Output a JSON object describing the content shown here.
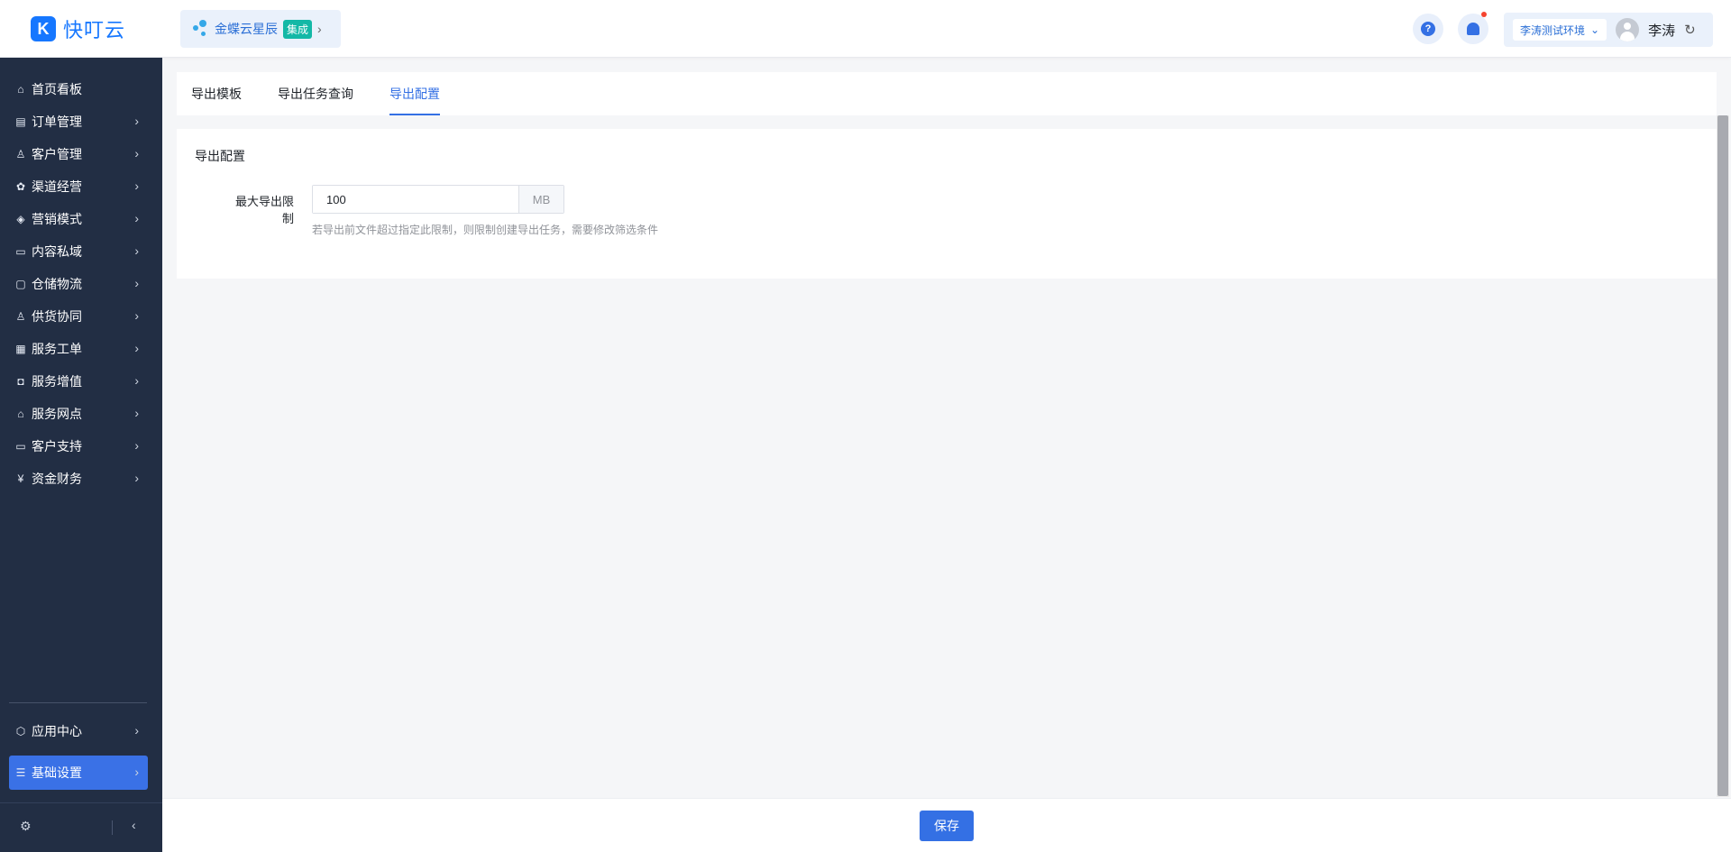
{
  "brand": {
    "name": "快叮云"
  },
  "integration": {
    "label": "金蝶云星辰",
    "badge": "集成"
  },
  "header": {
    "env_label": "李涛测试环境",
    "user_name": "李涛"
  },
  "sidebar": {
    "items": [
      {
        "label": "首页看板",
        "icon": "home-icon"
      },
      {
        "label": "订单管理",
        "icon": "clipboard-icon"
      },
      {
        "label": "客户管理",
        "icon": "user-icon"
      },
      {
        "label": "渠道经营",
        "icon": "channel-icon"
      },
      {
        "label": "营销模式",
        "icon": "tag-icon"
      },
      {
        "label": "内容私域",
        "icon": "image-icon"
      },
      {
        "label": "仓储物流",
        "icon": "warehouse-icon"
      },
      {
        "label": "供货协同",
        "icon": "supplier-icon"
      },
      {
        "label": "服务工单",
        "icon": "ticket-icon"
      },
      {
        "label": "服务增值",
        "icon": "bag-icon"
      },
      {
        "label": "服务网点",
        "icon": "store-icon"
      },
      {
        "label": "客户支持",
        "icon": "support-icon"
      },
      {
        "label": "资金财务",
        "icon": "yen-icon"
      }
    ],
    "bottom_items": [
      {
        "label": "应用中心",
        "icon": "cube-icon"
      },
      {
        "label": "基础设置",
        "icon": "settings-sliders-icon",
        "active": true
      }
    ]
  },
  "tabs": [
    {
      "label": "导出模板"
    },
    {
      "label": "导出任务查询"
    },
    {
      "label": "导出配置",
      "active": true
    }
  ],
  "section": {
    "title": "导出配置",
    "field_label": "最大导出限制",
    "field_value": "100",
    "unit": "MB",
    "hint": "若导出前文件超过指定此限制，则限制创建导出任务，需要修改筛选条件"
  },
  "footer": {
    "save_label": "保存"
  },
  "colors": {
    "primary": "#3470e4",
    "sidebar_bg": "#222e44",
    "badge": "#14b8a6"
  }
}
